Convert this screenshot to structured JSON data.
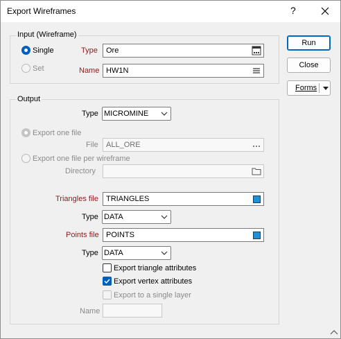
{
  "window": {
    "title": "Export Wireframes",
    "help": "?"
  },
  "input_group": {
    "title": "Input (Wireframe)",
    "single_label": "Single",
    "set_label": "Set",
    "type_label": "Type",
    "type_value": "Ore",
    "name_label": "Name",
    "name_value": "HW1N"
  },
  "output_group": {
    "title": "Output",
    "type_label": "Type",
    "type_value": "MICROMINE",
    "export_one_file_label": "Export one file",
    "file_label": "File",
    "file_value": "ALL_ORE",
    "export_per_wireframe_label": "Export one file per wireframe",
    "directory_label": "Directory",
    "directory_value": "",
    "triangles_file_label": "Triangles file",
    "triangles_file_value": "TRIANGLES",
    "triangles_type_label": "Type",
    "triangles_type_value": "DATA",
    "points_file_label": "Points file",
    "points_file_value": "POINTS",
    "points_type_label": "Type",
    "points_type_value": "DATA",
    "export_triangle_attributes_label": "Export triangle attributes",
    "export_triangle_attributes_checked": false,
    "export_vertex_attributes_label": "Export vertex attributes",
    "export_vertex_attributes_checked": true,
    "export_single_layer_label": "Export to a single layer",
    "export_single_layer_checked": false,
    "layer_name_label": "Name",
    "layer_name_value": ""
  },
  "buttons": {
    "run": "Run",
    "close": "Close",
    "forms": "Forms"
  },
  "colors": {
    "accent": "#005fb8",
    "required_label": "#8b1a1a",
    "color_swatch": "#1e90d8"
  },
  "icons": {
    "type_browse": "ellipsis-box-icon",
    "name_browse": "list-icon",
    "file_browse": "ellipsis-icon",
    "directory_browse": "folder-icon",
    "triangles_color": "color-swatch-icon",
    "points_color": "color-swatch-icon"
  }
}
